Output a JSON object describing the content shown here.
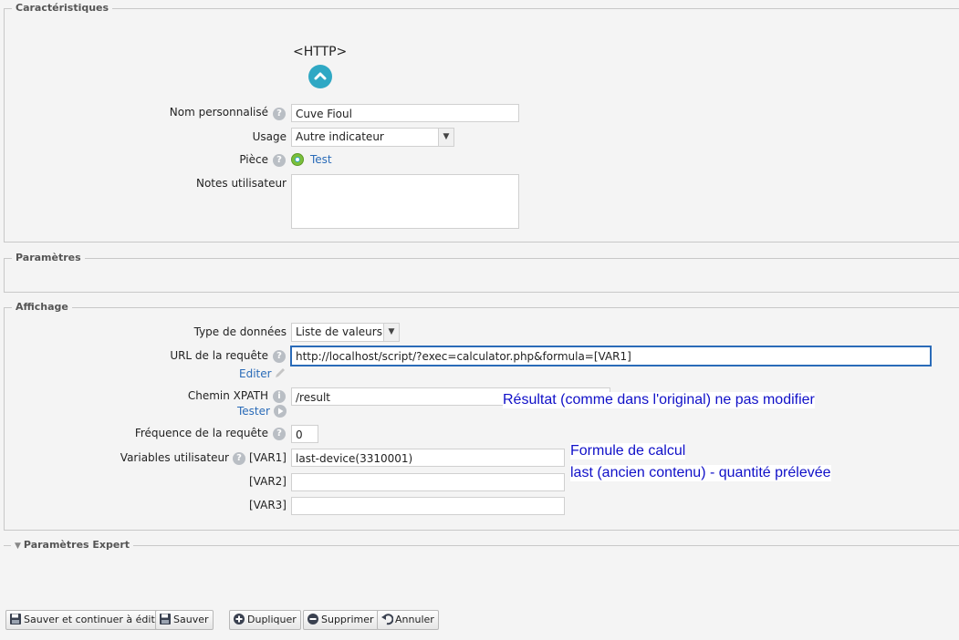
{
  "sections": {
    "caracteristiques": "Caractéristiques",
    "parametres": "Paramètres",
    "affichage": "Affichage",
    "expert": "Paramètres Expert"
  },
  "device_type": "<HTTP>",
  "fields": {
    "nom_label": "Nom personnalisé",
    "nom_value": "Cuve Fioul",
    "usage_label": "Usage",
    "usage_value": "Autre indicateur",
    "piece_label": "Pièce",
    "piece_value": "Test",
    "notes_label": "Notes utilisateur",
    "notes_value": "",
    "type_label": "Type de données",
    "type_value": "Liste de valeurs",
    "url_label": "URL de la requête",
    "url_value": "http://localhost/script/?exec=calculator.php&formula=[VAR1]",
    "editer": "Editer",
    "xpath_label": "Chemin XPATH",
    "xpath_value": "/result",
    "tester": "Tester",
    "freq_label": "Fréquence de la requête",
    "freq_value": "0",
    "vars_label": "Variables utilisateur",
    "var1_label": "[VAR1]",
    "var1_value": "last-device(3310001)",
    "var2_label": "[VAR2]",
    "var2_value": "",
    "var3_label": "[VAR3]",
    "var3_value": ""
  },
  "annotations": {
    "xpath_note": "Résultat (comme dans l'original) ne pas modifier",
    "formula_line1": "Formule de calcul",
    "formula_line2": "last (ancien contenu) - quantité prélevée"
  },
  "buttons": {
    "save_continue": "Sauver et continuer à éditer",
    "save": "Sauver",
    "duplicate": "Dupliquer",
    "delete": "Supprimer",
    "cancel": "Annuler"
  },
  "colors": {
    "accent": "#2fa8c4",
    "link": "#2a6bb8",
    "annotation": "#1010c8"
  }
}
